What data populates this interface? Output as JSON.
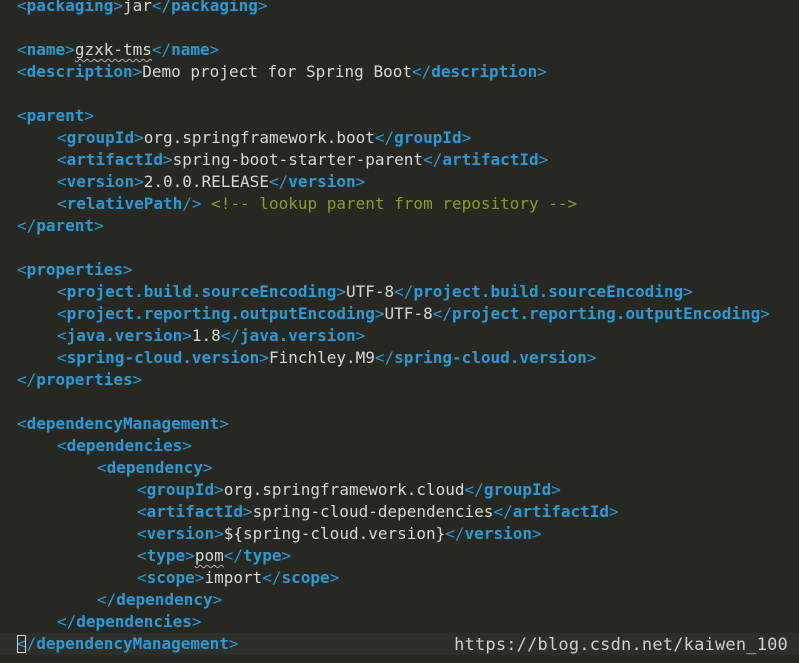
{
  "editor": {
    "lines": [
      {
        "indent": 0,
        "segs": [
          [
            "br",
            "<"
          ],
          [
            "tag",
            "packaging"
          ],
          [
            "br",
            ">"
          ],
          [
            "txt",
            "jar"
          ],
          [
            "br",
            "</"
          ],
          [
            "tag",
            "packaging"
          ],
          [
            "br",
            ">"
          ]
        ]
      },
      {
        "indent": 0,
        "segs": []
      },
      {
        "indent": 0,
        "segs": [
          [
            "br",
            "<"
          ],
          [
            "tag",
            "name"
          ],
          [
            "br",
            ">"
          ],
          [
            "spell",
            "gzxk-tms"
          ],
          [
            "br",
            "</"
          ],
          [
            "tag",
            "name"
          ],
          [
            "br",
            ">"
          ]
        ]
      },
      {
        "indent": 0,
        "segs": [
          [
            "br",
            "<"
          ],
          [
            "tag",
            "description"
          ],
          [
            "br",
            ">"
          ],
          [
            "txt",
            "Demo project for Spring Boot"
          ],
          [
            "br",
            "</"
          ],
          [
            "tag",
            "description"
          ],
          [
            "br",
            ">"
          ]
        ]
      },
      {
        "indent": 0,
        "segs": []
      },
      {
        "indent": 0,
        "segs": [
          [
            "br",
            "<"
          ],
          [
            "tag",
            "parent"
          ],
          [
            "br",
            ">"
          ]
        ]
      },
      {
        "indent": 4,
        "segs": [
          [
            "br",
            "<"
          ],
          [
            "tag",
            "groupId"
          ],
          [
            "br",
            ">"
          ],
          [
            "txt",
            "org.springframework.boot"
          ],
          [
            "br",
            "</"
          ],
          [
            "tag",
            "groupId"
          ],
          [
            "br",
            ">"
          ]
        ]
      },
      {
        "indent": 4,
        "segs": [
          [
            "br",
            "<"
          ],
          [
            "tag",
            "artifactId"
          ],
          [
            "br",
            ">"
          ],
          [
            "txt",
            "spring-boot-starter-parent"
          ],
          [
            "br",
            "</"
          ],
          [
            "tag",
            "artifactId"
          ],
          [
            "br",
            ">"
          ]
        ]
      },
      {
        "indent": 4,
        "segs": [
          [
            "br",
            "<"
          ],
          [
            "tag",
            "version"
          ],
          [
            "br",
            ">"
          ],
          [
            "txt",
            "2.0.0.RELEASE"
          ],
          [
            "br",
            "</"
          ],
          [
            "tag",
            "version"
          ],
          [
            "br",
            ">"
          ]
        ]
      },
      {
        "indent": 4,
        "segs": [
          [
            "br",
            "<"
          ],
          [
            "tag",
            "relativePath"
          ],
          [
            "br",
            "/>"
          ],
          [
            "txt",
            " "
          ],
          [
            "cm",
            "<!-- lookup parent from repository -->"
          ]
        ]
      },
      {
        "indent": 0,
        "segs": [
          [
            "br",
            "</"
          ],
          [
            "tag",
            "parent"
          ],
          [
            "br",
            ">"
          ]
        ]
      },
      {
        "indent": 0,
        "segs": []
      },
      {
        "indent": 0,
        "segs": [
          [
            "br",
            "<"
          ],
          [
            "tag",
            "properties"
          ],
          [
            "br",
            ">"
          ]
        ]
      },
      {
        "indent": 4,
        "segs": [
          [
            "br",
            "<"
          ],
          [
            "tag",
            "project.build.sourceEncoding"
          ],
          [
            "br",
            ">"
          ],
          [
            "txt",
            "UTF-8"
          ],
          [
            "br",
            "</"
          ],
          [
            "tag",
            "project.build.sourceEncoding"
          ],
          [
            "br",
            ">"
          ]
        ]
      },
      {
        "indent": 4,
        "segs": [
          [
            "br",
            "<"
          ],
          [
            "tag",
            "project.reporting.outputEncoding"
          ],
          [
            "br",
            ">"
          ],
          [
            "txt",
            "UTF-8"
          ],
          [
            "br",
            "</"
          ],
          [
            "tag",
            "project.reporting.outputEncoding"
          ],
          [
            "br",
            ">"
          ]
        ]
      },
      {
        "indent": 4,
        "segs": [
          [
            "br",
            "<"
          ],
          [
            "tag",
            "java.version"
          ],
          [
            "br",
            ">"
          ],
          [
            "txt",
            "1.8"
          ],
          [
            "br",
            "</"
          ],
          [
            "tag",
            "java.version"
          ],
          [
            "br",
            ">"
          ]
        ]
      },
      {
        "indent": 4,
        "segs": [
          [
            "br",
            "<"
          ],
          [
            "tag",
            "spring-cloud.version"
          ],
          [
            "br",
            ">"
          ],
          [
            "txt",
            "Finchley.M9"
          ],
          [
            "br",
            "</"
          ],
          [
            "tag",
            "spring-cloud.version"
          ],
          [
            "br",
            ">"
          ]
        ]
      },
      {
        "indent": 0,
        "segs": [
          [
            "br",
            "</"
          ],
          [
            "tag",
            "properties"
          ],
          [
            "br",
            ">"
          ]
        ]
      },
      {
        "indent": 0,
        "segs": []
      },
      {
        "indent": 0,
        "segs": [
          [
            "br",
            "<"
          ],
          [
            "tag",
            "dependencyManagement"
          ],
          [
            "br",
            ">"
          ]
        ]
      },
      {
        "indent": 4,
        "segs": [
          [
            "br",
            "<"
          ],
          [
            "tag",
            "dependencies"
          ],
          [
            "br",
            ">"
          ]
        ]
      },
      {
        "indent": 8,
        "segs": [
          [
            "br",
            "<"
          ],
          [
            "tag",
            "dependency"
          ],
          [
            "br",
            ">"
          ]
        ]
      },
      {
        "indent": 12,
        "segs": [
          [
            "br",
            "<"
          ],
          [
            "tag",
            "groupId"
          ],
          [
            "br",
            ">"
          ],
          [
            "txt",
            "org.springframework.cloud"
          ],
          [
            "br",
            "</"
          ],
          [
            "tag",
            "groupId"
          ],
          [
            "br",
            ">"
          ]
        ]
      },
      {
        "indent": 12,
        "segs": [
          [
            "br",
            "<"
          ],
          [
            "tag",
            "artifactId"
          ],
          [
            "br",
            ">"
          ],
          [
            "txt",
            "spring-cloud-dependencies"
          ],
          [
            "br",
            "</"
          ],
          [
            "tag",
            "artifactId"
          ],
          [
            "br",
            ">"
          ]
        ]
      },
      {
        "indent": 12,
        "segs": [
          [
            "br",
            "<"
          ],
          [
            "tag",
            "version"
          ],
          [
            "br",
            ">"
          ],
          [
            "txt",
            "${spring-cloud.version}"
          ],
          [
            "br",
            "</"
          ],
          [
            "tag",
            "version"
          ],
          [
            "br",
            ">"
          ]
        ]
      },
      {
        "indent": 12,
        "segs": [
          [
            "br",
            "<"
          ],
          [
            "tag",
            "type"
          ],
          [
            "br",
            ">"
          ],
          [
            "spell",
            "pom"
          ],
          [
            "br",
            "</"
          ],
          [
            "tag",
            "type"
          ],
          [
            "br",
            ">"
          ]
        ]
      },
      {
        "indent": 12,
        "segs": [
          [
            "br",
            "<"
          ],
          [
            "tag",
            "scope"
          ],
          [
            "br",
            ">"
          ],
          [
            "txt",
            "import"
          ],
          [
            "br",
            "</"
          ],
          [
            "tag",
            "scope"
          ],
          [
            "br",
            ">"
          ]
        ]
      },
      {
        "indent": 8,
        "segs": [
          [
            "br",
            "</"
          ],
          [
            "tag",
            "dependency"
          ],
          [
            "br",
            ">"
          ]
        ]
      },
      {
        "indent": 4,
        "segs": [
          [
            "br",
            "</"
          ],
          [
            "tag",
            "dependencies"
          ],
          [
            "br",
            ">"
          ]
        ]
      },
      {
        "indent": 0,
        "current": true,
        "segs": [
          [
            "br",
            "</"
          ],
          [
            "tag",
            "dependencyManagement"
          ],
          [
            "br",
            ">"
          ]
        ]
      }
    ]
  },
  "watermark": "https://blog.csdn.net/kaiwen_100"
}
